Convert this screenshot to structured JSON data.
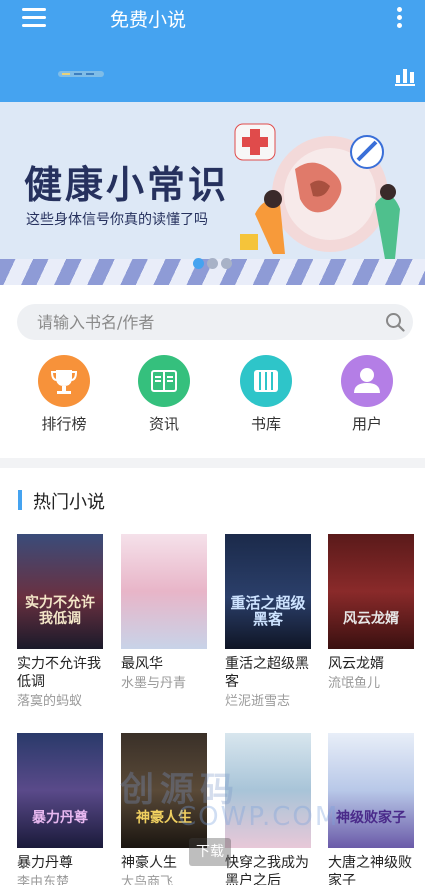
{
  "header": {
    "title": "免费小说",
    "menu_icon": "hamburger-menu-icon",
    "more_icon": "vertical-dots-icon",
    "stats_icon": "bar-chart-icon",
    "background": "#45a3f0"
  },
  "banner": {
    "title": "健康小常识",
    "subtitle": "这些身体信号你真的读懂了吗",
    "total_slides": 3,
    "active_slide": 1
  },
  "search": {
    "placeholder": "请输入书名/作者",
    "icon": "search-icon"
  },
  "quick_nav": [
    {
      "label": "排行榜",
      "icon": "trophy-icon",
      "color": "#f7923a"
    },
    {
      "label": "资讯",
      "icon": "news-icon",
      "color": "#35c07d"
    },
    {
      "label": "书库",
      "icon": "library-icon",
      "color": "#2ec5c9"
    },
    {
      "label": "用户",
      "icon": "user-icon",
      "color": "#b47ee6"
    }
  ],
  "hot_section": {
    "title": "热门小说",
    "books": [
      {
        "title": "实力不允许我低调",
        "author": "落寞的蚂蚁",
        "cover_text": "实力不允许我低调"
      },
      {
        "title": "最风华",
        "author": "水墨与丹青",
        "cover_text": ""
      },
      {
        "title": "重活之超级黑客",
        "author": "烂泥逝雪志",
        "cover_text": "重活之超级黑客"
      },
      {
        "title": "风云龙婿",
        "author": "流氓鱼儿",
        "cover_text": "风云龙婿"
      },
      {
        "title": "暴力丹尊",
        "author": "李由东楚",
        "cover_text": "暴力丹尊"
      },
      {
        "title": "神豪人生",
        "author": "大鸟商飞",
        "cover_text": "神豪人生"
      },
      {
        "title": "快穿之我成为黑户之后",
        "author": "",
        "cover_text": ""
      },
      {
        "title": "大唐之神级败家子",
        "author": "",
        "cover_text": "神级败家子"
      }
    ]
  },
  "watermark": {
    "text": "创源码",
    "sub": "COWP.COM"
  },
  "download_tab": {
    "label": "下载"
  }
}
